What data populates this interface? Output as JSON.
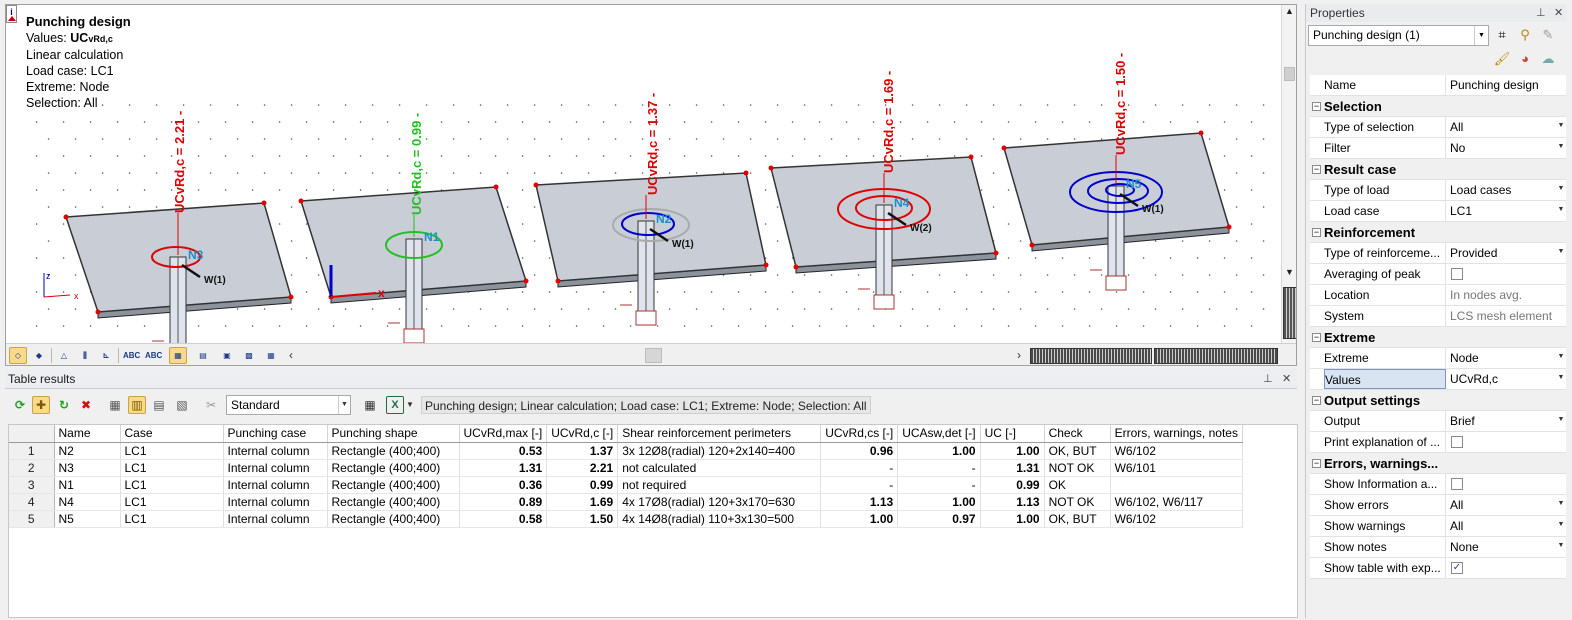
{
  "colors": {
    "red": "#e00000",
    "green": "#22c022",
    "accent_highlight": "#f9d98a",
    "slab_fill": "#c9ced6",
    "label_blue": "#1a8fd0"
  },
  "viewport": {
    "info": {
      "title": "Punching design",
      "values_label": "Values:",
      "values_main": "UC",
      "values_sub": "vRd,c",
      "calc": "Linear calculation",
      "load_case": "Load case: LC1",
      "extreme": "Extreme: Node",
      "selection": "Selection: All"
    },
    "axis_labels": {
      "x": "x",
      "z": "z"
    },
    "nodes": [
      {
        "id": "N3",
        "uc_label": "UCvRd,c = 2.21 -",
        "load": "W(1)",
        "ok": false
      },
      {
        "id": "N1",
        "uc_label": "UCvRd,c = 0.99 -",
        "load": "",
        "ok": true
      },
      {
        "id": "N2",
        "uc_label": "UCvRd,c = 1.37 -",
        "load": "W(1)",
        "ok": false
      },
      {
        "id": "N4",
        "uc_label": "UCvRd,c = 1.69 -",
        "load": "W(2)",
        "ok": false
      },
      {
        "id": "N5",
        "uc_label": "UCvRd,c = 1.50 -",
        "load": "W(1)",
        "ok": false
      }
    ]
  },
  "table_panel": {
    "title": "Table results",
    "preset": "Standard",
    "description": "Punching design; Linear calculation; Load case: LC1; Extreme: Node; Selection: All",
    "columns": [
      "Name",
      "Case",
      "Punching case",
      "Punching shape",
      "UCvRd,max [-]",
      "UCvRd,c [-]",
      "Shear reinforcement perimeters",
      "UCvRd,cs [-]",
      "UCAsw,det [-]",
      "UC [-]",
      "Check",
      "Errors, warnings, notes"
    ],
    "rows": [
      {
        "n": "1",
        "name": "N2",
        "case": "LC1",
        "pcase": "Internal column",
        "shape": "Rectangle (400;400)",
        "ucmax": "0.53",
        "ucc": "1.37",
        "shear": "3x 12Ø8(radial) 120+2x140=400",
        "uccs": "0.96",
        "ucasw": "1.00",
        "uc": "1.00",
        "check": "OK, BUT",
        "notes": "W6/102"
      },
      {
        "n": "2",
        "name": "N3",
        "case": "LC1",
        "pcase": "Internal column",
        "shape": "Rectangle (400;400)",
        "ucmax": "1.31",
        "ucc": "2.21",
        "shear": "not calculated",
        "uccs": "-",
        "ucasw": "-",
        "uc": "1.31",
        "check": "NOT OK",
        "notes": "W6/101"
      },
      {
        "n": "3",
        "name": "N1",
        "case": "LC1",
        "pcase": "Internal column",
        "shape": "Rectangle (400;400)",
        "ucmax": "0.36",
        "ucc": "0.99",
        "shear": "not required",
        "uccs": "-",
        "ucasw": "-",
        "uc": "0.99",
        "check": "OK",
        "notes": ""
      },
      {
        "n": "4",
        "name": "N4",
        "case": "LC1",
        "pcase": "Internal column",
        "shape": "Rectangle (400;400)",
        "ucmax": "0.89",
        "ucc": "1.69",
        "shear": "4x 17Ø8(radial) 120+3x170=630",
        "uccs": "1.13",
        "ucasw": "1.00",
        "uc": "1.13",
        "check": "NOT OK",
        "notes": "W6/102, W6/117"
      },
      {
        "n": "5",
        "name": "N5",
        "case": "LC1",
        "pcase": "Internal column",
        "shape": "Rectangle (400;400)",
        "ucmax": "0.58",
        "ucc": "1.50",
        "shear": "4x 14Ø8(radial) 110+3x130=500",
        "uccs": "1.00",
        "ucasw": "0.97",
        "uc": "1.00",
        "check": "OK, BUT",
        "notes": "W6/102"
      }
    ]
  },
  "properties": {
    "title": "Properties",
    "object": "Punching design (1)",
    "name_label": "Name",
    "name_value": "Punching design",
    "groups": [
      {
        "title": "Selection",
        "items": [
          {
            "k": "Type of selection",
            "v": "All",
            "dd": true
          },
          {
            "k": "Filter",
            "v": "No",
            "dd": true
          }
        ]
      },
      {
        "title": "Result case",
        "items": [
          {
            "k": "Type of load",
            "v": "Load cases",
            "dd": true
          },
          {
            "k": "Load case",
            "v": "LC1",
            "dd": true
          }
        ]
      },
      {
        "title": "Reinforcement",
        "items": [
          {
            "k": "Type of reinforceme...",
            "v": "Provided",
            "dd": true
          },
          {
            "k": "Averaging of peak",
            "cb": false
          },
          {
            "k": "Location",
            "v": "In nodes avg.",
            "gray": true
          },
          {
            "k": "System",
            "v": "LCS mesh element",
            "gray": true
          }
        ]
      },
      {
        "title": "Extreme",
        "items": [
          {
            "k": "Extreme",
            "v": "Node",
            "dd": true
          },
          {
            "k": "Values",
            "v": "UCvRd,c",
            "dd": true,
            "sel": true
          }
        ]
      },
      {
        "title": "Output settings",
        "items": [
          {
            "k": "Output",
            "v": "Brief",
            "dd": true
          },
          {
            "k": "Print explanation of ...",
            "cb": false
          }
        ]
      },
      {
        "title": "Errors, warnings...",
        "items": [
          {
            "k": "Show Information a...",
            "cb": false
          },
          {
            "k": "Show errors",
            "v": "All",
            "dd": true
          },
          {
            "k": "Show warnings",
            "v": "All",
            "dd": true
          },
          {
            "k": "Show notes",
            "v": "None",
            "dd": true
          },
          {
            "k": "Show table with exp...",
            "cb": true
          }
        ]
      }
    ]
  }
}
